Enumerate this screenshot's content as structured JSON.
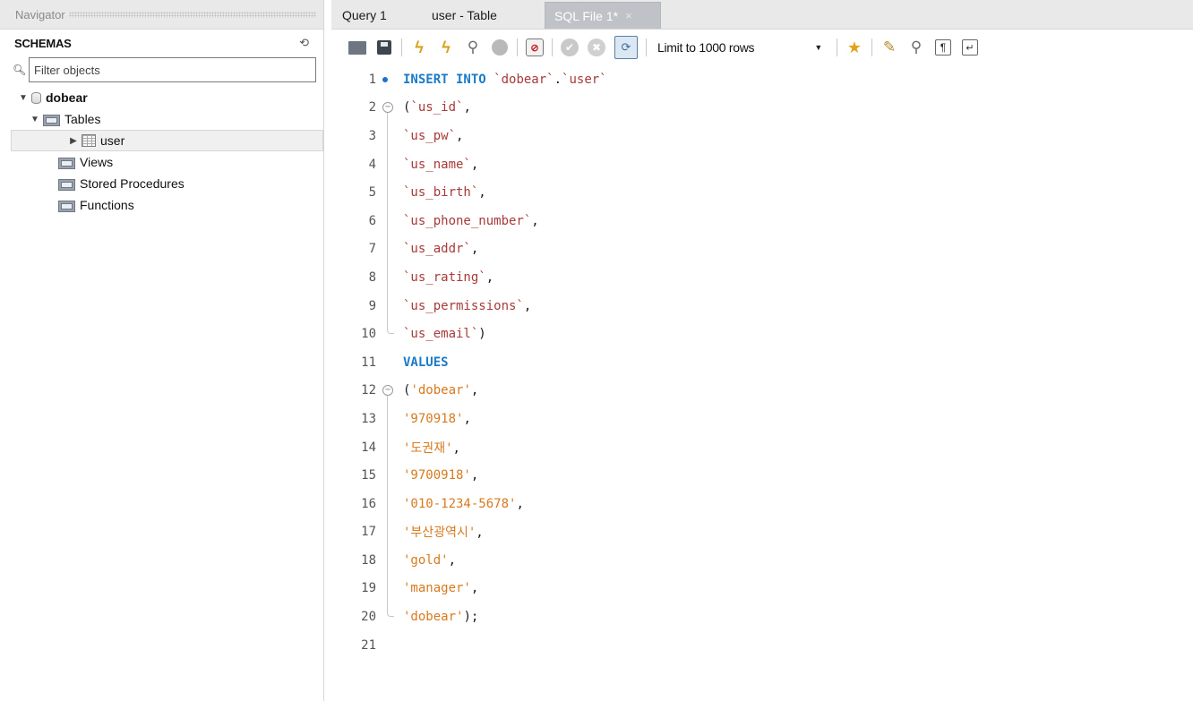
{
  "navigator": {
    "header": "Navigator",
    "schemas_title": "SCHEMAS",
    "filter_placeholder": "Filter objects",
    "tree": {
      "schema": "dobear",
      "tables": "Tables",
      "table_user": "user",
      "views": "Views",
      "stored_procedures": "Stored Procedures",
      "functions": "Functions"
    }
  },
  "tabs": [
    {
      "label": "Query 1"
    },
    {
      "label": "user - Table"
    },
    {
      "label": "SQL File 1*",
      "close": "×"
    }
  ],
  "toolbar": {
    "limit_label": "Limit to 1000 rows",
    "icons": [
      "open-file-icon",
      "save-icon",
      "execute-icon",
      "execute-current-icon",
      "explain-icon",
      "stop-icon",
      "error-toggle-icon",
      "commit-icon",
      "rollback-icon",
      "autocommit-icon",
      "beautify-star-icon",
      "format-icon",
      "find-icon",
      "invisible-chars-icon",
      "wrap-icon"
    ]
  },
  "colors": {
    "keyword": "#1b7bc8",
    "identifier": "#a83a3a",
    "string": "#d87a1e",
    "active_tab": "#bfc3c8"
  },
  "code": {
    "line_numbers": [
      "1",
      "2",
      "3",
      "4",
      "5",
      "6",
      "7",
      "8",
      "9",
      "10",
      "11",
      "12",
      "13",
      "14",
      "15",
      "16",
      "17",
      "18",
      "19",
      "20",
      "21"
    ],
    "l1_kw": "INSERT INTO",
    "l1_db": "`dobear`",
    "l1_dot": ".",
    "l1_tbl": "`user`",
    "l2_open": "(",
    "l2_id": "`us_id`",
    "l3_id": "`us_pw`",
    "l4_id": "`us_name`",
    "l5_id": "`us_birth`",
    "l6_id": "`us_phone_number`",
    "l7_id": "`us_addr`",
    "l8_id": "`us_rating`",
    "l9_id": "`us_permissions`",
    "l10_id": "`us_email`",
    "l10_close": ")",
    "l11_kw": "VALUES",
    "l12_open": "(",
    "l12_str": "'dobear'",
    "l13_str": "'970918'",
    "l14_str": "'도권재'",
    "l15_str": "'9700918'",
    "l16_str": "'010-1234-5678'",
    "l17_str": "'부산광역시'",
    "l18_str": "'gold'",
    "l19_str": "'manager'",
    "l20_str": "'dobear'",
    "l20_close": ");",
    "comma": ","
  }
}
